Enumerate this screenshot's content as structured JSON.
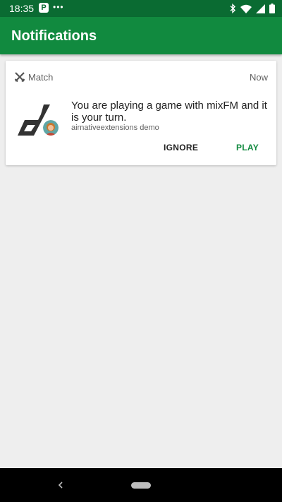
{
  "status_bar": {
    "time": "18:35",
    "icons": [
      "p-app-icon",
      "more-dots-icon",
      "bluetooth-icon",
      "wifi-icon",
      "signal-icon",
      "battery-icon"
    ],
    "color": "#0a6b32"
  },
  "app_bar": {
    "title": "Notifications",
    "color": "#118a3f"
  },
  "notification": {
    "channel_icon": "crossed-swords-icon",
    "channel": "Match",
    "time": "Now",
    "message": "You are playing a game with mixFM and it is your turn.",
    "source": "airnativeextensions demo",
    "app_icon": "app-logo-icon",
    "avatar_icon": "user-avatar-icon",
    "actions": {
      "ignore": "IGNORE",
      "play": "PLAY"
    },
    "accent": "#118a3f"
  },
  "nav_bar": {
    "icons": [
      "back-icon",
      "home-pill-icon"
    ]
  }
}
